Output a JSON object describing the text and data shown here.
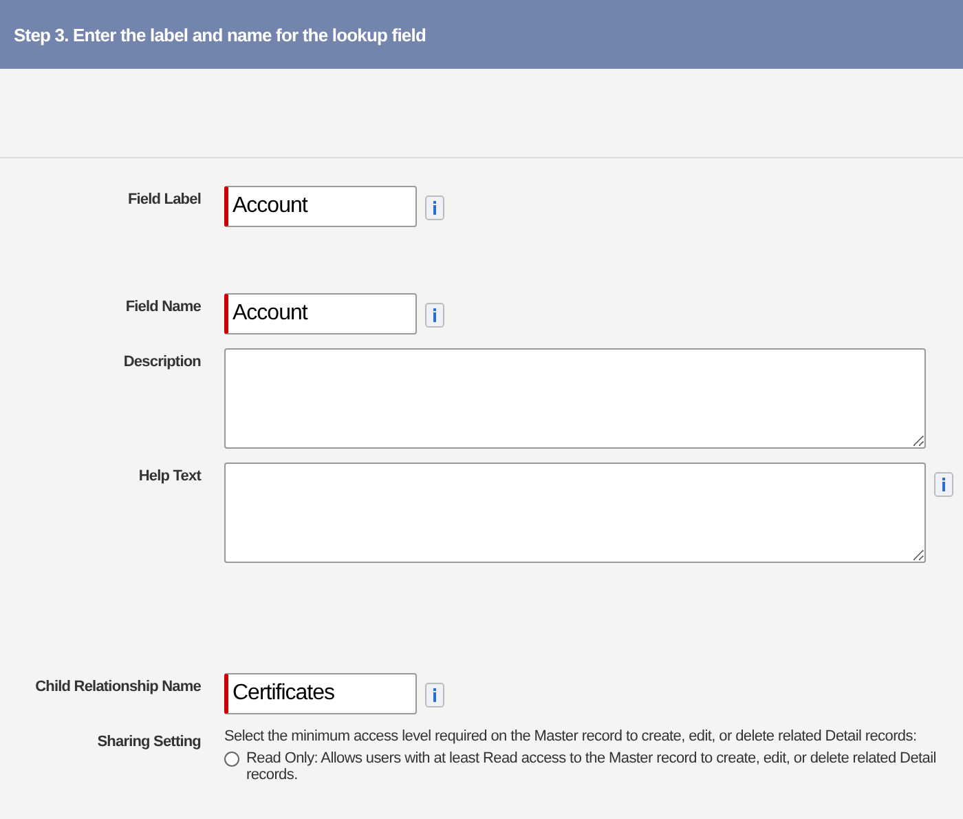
{
  "header": {
    "title": "Step 3. Enter the label and name for the lookup field"
  },
  "fields": [
    {
      "kind": "text",
      "label": "Field Label",
      "value": "Account",
      "required": true,
      "info": true
    },
    {
      "kind": "text",
      "label": "Field Name",
      "value": "Account",
      "required": true,
      "info": true
    },
    {
      "kind": "textarea",
      "label": "Description",
      "required": false,
      "info": false
    },
    {
      "kind": "textarea",
      "label": "Help Text",
      "required": false,
      "info": true
    },
    {
      "kind": "text",
      "label": "Child Relationship Name",
      "value": "Certificates",
      "required": true,
      "info": true
    }
  ],
  "sharing": {
    "label": "Sharing Setting",
    "instruction": "Select the minimum access level required on the Master record to create, edit, or delete related Detail records:",
    "options": [
      {
        "label": "Read Only: Allows users with at least Read access to the Master record to create, edit, or delete related Detail records.",
        "selected": false
      }
    ]
  }
}
